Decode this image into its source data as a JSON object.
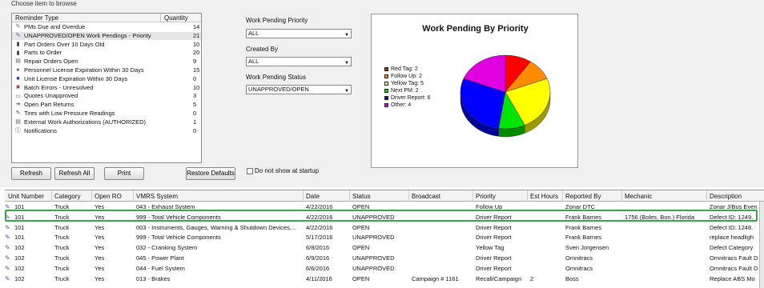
{
  "browse": {
    "title": "Choose item to browse",
    "columns": [
      "Reminder Type",
      "Quantity"
    ],
    "items": [
      {
        "label": "PMs Due and Overdue",
        "qty": "14",
        "icon": "wrench-icon"
      },
      {
        "label": "UNAPPROVED/OPEN Work Pendings - Priority",
        "qty": "21",
        "icon": "wrench-icon"
      },
      {
        "label": "Part Orders Over 10 Days Old",
        "qty": "10",
        "icon": "part-icon"
      },
      {
        "label": "Parts to Order",
        "qty": "20",
        "icon": "part-icon"
      },
      {
        "label": "Repair Orders Open",
        "qty": "9",
        "icon": "document-icon"
      },
      {
        "label": "Personnel License Expiration Within 30 Days",
        "qty": "15",
        "icon": "person-icon"
      },
      {
        "label": "Unit License Expiration Within 30 Days",
        "qty": "0",
        "icon": "truck-icon"
      },
      {
        "label": "Batch Errors - Unresolved",
        "qty": "10",
        "icon": "error-icon"
      },
      {
        "label": "Quotes Unapproved",
        "qty": "3",
        "icon": "quote-icon"
      },
      {
        "label": "Open Part Returns",
        "qty": "5",
        "icon": "return-icon"
      },
      {
        "label": "Tires with Low Pressure Readings",
        "qty": "0",
        "icon": "tire-icon"
      },
      {
        "label": "External Work Authorizations (AUTHORIZED)",
        "qty": "1",
        "icon": "document-icon"
      },
      {
        "label": "Notifications",
        "qty": "0",
        "icon": "notification-icon"
      }
    ],
    "selected_index": 1
  },
  "buttons": {
    "refresh": "Refresh",
    "refresh_all": "Refresh All",
    "print": "Print",
    "restore_defaults": "Restore Defaults"
  },
  "startup_checkbox": {
    "label": "Do not show at startup",
    "checked": false
  },
  "filters": {
    "priority": {
      "label": "Work Pending Priority",
      "value": "ALL"
    },
    "created_by": {
      "label": "Created By",
      "value": "ALL"
    },
    "status": {
      "label": "Work Pending Status",
      "value": "UNAPPROVED/OPEN"
    }
  },
  "chart_data": {
    "type": "pie",
    "title": "Work Pending By Priority",
    "legend_position": "left",
    "categories": [
      "Red Tag: 2",
      "Follow Up: 2",
      "Yellow Tag: 5",
      "Next PM: 2",
      "Driver Report: 6",
      "Other: 4"
    ],
    "values": [
      2,
      2,
      5,
      2,
      6,
      4
    ],
    "colors": [
      "#ff0000",
      "#ff8c00",
      "#ffff00",
      "#00e600",
      "#0000ff",
      "#e000e0"
    ]
  },
  "grid": {
    "columns": [
      "Unit Number",
      "Category",
      "Open RO",
      "VMRS System",
      "Date",
      "Status",
      "Broadcast",
      "Priority",
      "Est Hours",
      "Reported By",
      "Mechanic",
      "Description"
    ],
    "rows": [
      [
        "101",
        "Truck",
        "Yes",
        "043 - Exhaust System",
        "4/22/2016",
        "OPEN",
        "",
        "Follow Up",
        "",
        "Zonar DTC",
        "",
        "Zonar J/Bus Even"
      ],
      [
        "101",
        "Truck",
        "Yes",
        "999 - Total Vehicle Components",
        "4/22/2016",
        "UNAPPROVED",
        "",
        "Driver Report",
        "",
        "Frank Barnes",
        "1756 (Boles, Bon.) Florida",
        "Defect ID: 1249."
      ],
      [
        "101",
        "Truck",
        "Yes",
        "003 - Instruments, Gauges, Warning & Shutdown Devices,...",
        "4/22/2016",
        "OPEN",
        "",
        "Driver Report",
        "",
        "Frank Barnes",
        "",
        "Defect ID: 1248."
      ],
      [
        "101",
        "Truck",
        "Yes",
        "999 - Total Vehicle Components",
        "5/17/2016",
        "UNAPPROVED",
        "",
        "Driver Report",
        "",
        "Frank Barnes",
        "",
        "replace headligh"
      ],
      [
        "102",
        "Truck",
        "Yes",
        "032 - Cranking System",
        "6/8/2016",
        "OPEN",
        "",
        "Yellow Tag",
        "",
        "Sven Jorgensen",
        "",
        "Defect Category"
      ],
      [
        "102",
        "Truck",
        "Yes",
        "045 - Power Plant",
        "6/9/2016",
        "UNAPPROVED",
        "",
        "Driver Report",
        "",
        "Omnitracs",
        "",
        "Omnitracs Fault D"
      ],
      [
        "102",
        "Truck",
        "Yes",
        "044 - Fuel System",
        "6/6/2016",
        "UNAPPROVED",
        "",
        "Driver Report",
        "",
        "Omnitracs",
        "",
        "Omnitracs Fault D"
      ],
      [
        "102",
        "Truck",
        "Yes",
        "013 - Brakes",
        "4/11/2016",
        "OPEN",
        "Campaign # 1161",
        "Recall/Campaign",
        "2",
        "Boss",
        "",
        "Replace ABS Mo"
      ]
    ]
  }
}
